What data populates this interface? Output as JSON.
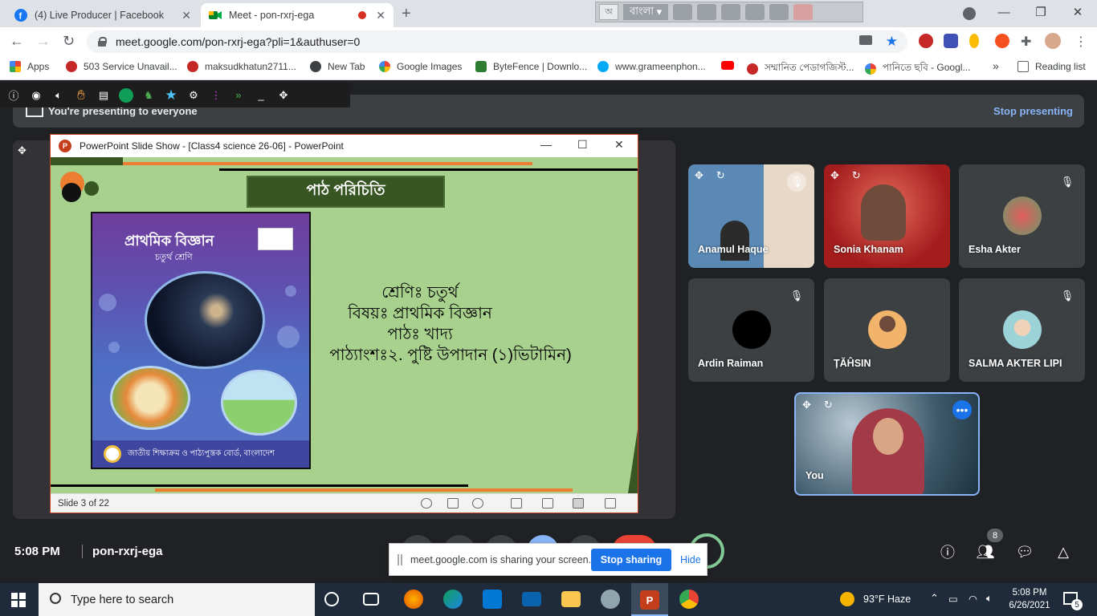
{
  "browser": {
    "tabs": [
      {
        "title": "(4) Live Producer | Facebook",
        "icon": "facebook-icon",
        "active": false
      },
      {
        "title": "Meet - pon-rxrj-ega",
        "icon": "meet-icon",
        "active": true
      }
    ],
    "language_bar": {
      "ime_indicator": "অ",
      "language": "বাংলা"
    },
    "url": "meet.google.com/pon-rxrj-ega?pli=1&authuser=0",
    "bookmarks": [
      {
        "label": "Apps"
      },
      {
        "label": "503 Service Unavail..."
      },
      {
        "label": "maksudkhatun2711..."
      },
      {
        "label": "New Tab"
      },
      {
        "label": "Google Images"
      },
      {
        "label": "ByteFence | Downlo..."
      },
      {
        "label": "www.grameenphon..."
      },
      {
        "label": ""
      },
      {
        "label": "সম্মানিত পেডাগজিস্ট..."
      },
      {
        "label": "পানিতে ছবি - Googl..."
      }
    ],
    "bookmarks_more": "»",
    "reading_list": "Reading list"
  },
  "meet": {
    "banner_text": "You're presenting to everyone",
    "stop_presenting": "Stop presenting",
    "ppt": {
      "window_title": "PowerPoint Slide Show - [Class4 science 26-06] - PowerPoint",
      "status": "Slide 3 of 22"
    },
    "slide": {
      "title": "পাঠ পরিচিতি",
      "lines": [
        "শ্রেণিঃ চতুর্থ",
        "বিষয়ঃ প্রাথমিক বিজ্ঞান",
        "পাঠঃ খাদ্য",
        "পাঠ্যাংশঃ২. পুষ্টি উপাদান (১)ভিটামিন)"
      ],
      "book": {
        "title": "প্রাথমিক বিজ্ঞান",
        "subtitle": "চতুর্থ শ্রেণি",
        "footer": "জাতীয় শিক্ষাক্রম ও পাঠ্যপুস্তক বোর্ড, বাংলাদেশ"
      }
    },
    "participants": [
      {
        "name": "Anamul Haque",
        "muted": true
      },
      {
        "name": "Sonia Khanam",
        "muted": false
      },
      {
        "name": "Esha Akter",
        "muted": true
      },
      {
        "name": "Ardin Raiman",
        "muted": true
      },
      {
        "name": "ȚĂĤSIN",
        "muted": false
      },
      {
        "name": "SALMA AKTER LIPI",
        "muted": true
      },
      {
        "name": "You",
        "muted": false
      }
    ],
    "time": "5:08 PM",
    "meeting_code": "pon-rxrj-ega",
    "people_count": "8",
    "share_bar": {
      "text": "meet.google.com is sharing your screen.",
      "stop": "Stop sharing",
      "hide": "Hide"
    }
  },
  "taskbar": {
    "search_placeholder": "Type here to search",
    "weather": "93°F  Haze",
    "time": "5:08 PM",
    "date": "6/26/2021",
    "notifications": "5"
  },
  "colors": {
    "meet_bg": "#202124",
    "slide_bg": "#a8d18d",
    "accent_blue": "#1a73e8",
    "slide_title_bg": "#375623"
  }
}
